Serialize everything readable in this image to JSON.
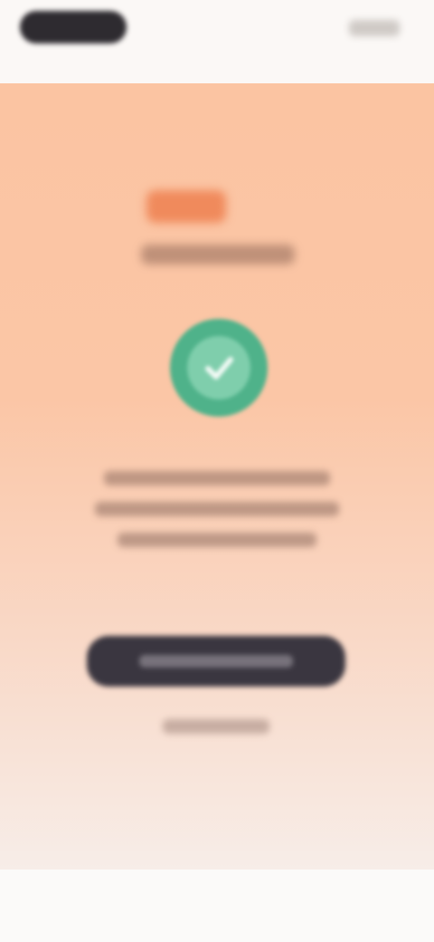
{
  "status_bar": {
    "back_pill_label": "",
    "status_icons": "status-icons"
  },
  "brand": {
    "logo_icon": "brand-logo-icon",
    "name": ""
  },
  "success": {
    "icon": "check-circle-icon",
    "color": "#4fb28a"
  },
  "message": {
    "lines": [
      "",
      "",
      ""
    ]
  },
  "actions": {
    "primary_label": "",
    "secondary_label": ""
  },
  "colors": {
    "sheet_top": "#fbc4a2",
    "sheet_bottom": "#f7ede8",
    "brand": "#f08a5c",
    "button": "#3a3640"
  }
}
